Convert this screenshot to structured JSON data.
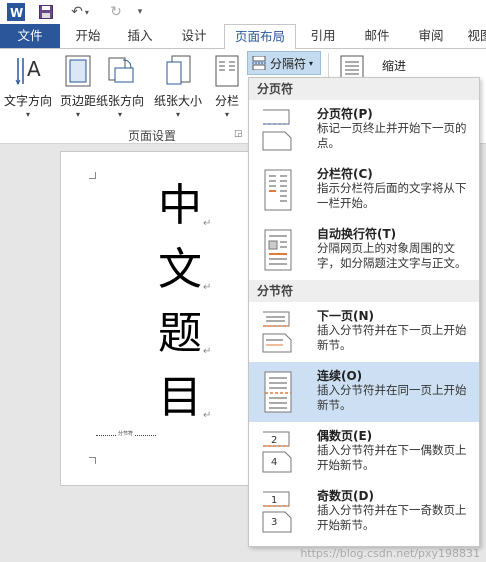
{
  "qat": {
    "word_icon": "word-app-icon",
    "save_icon": "save-icon",
    "undo_icon": "undo-icon",
    "redo_icon": "redo-icon",
    "customize_icon": "customize-qat-icon"
  },
  "tabs": {
    "file": "文件",
    "home": "开始",
    "insert": "插入",
    "design": "设计",
    "layout": "页面布局",
    "references": "引用",
    "mailings": "邮件",
    "review": "审阅",
    "view": "视图"
  },
  "ribbon": {
    "text_direction": "文字方向",
    "margins": "页边距",
    "orientation": "纸张方向",
    "size": "纸张大小",
    "columns": "分栏",
    "breaks": "分隔符",
    "indent": "缩进",
    "group_label": "页面设置"
  },
  "document": {
    "chars": [
      "中",
      "文",
      "题",
      "目"
    ],
    "section_break_label": "分节符"
  },
  "breaks_menu": {
    "page_breaks_header": "分页符",
    "section_breaks_header": "分节符",
    "items": [
      {
        "title": "分页符(P)",
        "desc": "标记一页终止并开始下一页的点。"
      },
      {
        "title": "分栏符(C)",
        "desc": "指示分栏符后面的文字将从下一栏开始。"
      },
      {
        "title": "自动换行符(T)",
        "desc": "分隔网页上的对象周围的文字，如分隔题注文字与正文。"
      },
      {
        "title": "下一页(N)",
        "desc": "插入分节符并在下一页上开始新节。"
      },
      {
        "title": "连续(O)",
        "desc": "插入分节符并在同一页上开始新节。"
      },
      {
        "title": "偶数页(E)",
        "desc": "插入分节符并在下一偶数页上开始新节。"
      },
      {
        "title": "奇数页(D)",
        "desc": "插入分节符并在下一奇数页上开始新节。"
      }
    ]
  },
  "watermark": "https://blog.csdn.net/pxy198831",
  "colors": {
    "file_tab": "#2b579a",
    "highlight": "#cde0f3",
    "accent_orange": "#e07b39"
  }
}
